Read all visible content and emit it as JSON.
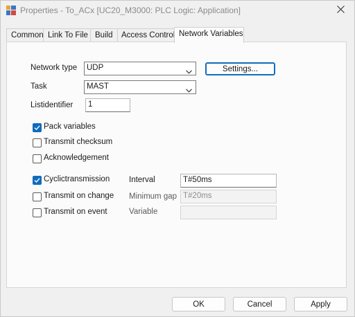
{
  "window": {
    "title": "Properties - To_ACx [UC20_M3000: PLC Logic: Application]",
    "close_icon": "close-icon",
    "app_icon": "properties-app-icon"
  },
  "tabs": [
    {
      "label": "Common",
      "active": false
    },
    {
      "label": "Link To File",
      "active": false
    },
    {
      "label": "Build",
      "active": false
    },
    {
      "label": "Access Control",
      "active": false
    },
    {
      "label": "Network Variables",
      "active": true
    }
  ],
  "form": {
    "network_type": {
      "label": "Network type",
      "value": "UDP"
    },
    "settings_button": "Settings...",
    "task": {
      "label": "Task",
      "value": "MAST"
    },
    "list_identifier": {
      "label": "Listidentifier",
      "value": "1"
    },
    "checkboxes": [
      {
        "label": "Pack variables",
        "checked": true
      },
      {
        "label": "Transmit checksum",
        "checked": false
      },
      {
        "label": "Acknowledgement",
        "checked": false
      },
      {
        "label": "Cyclictransmission",
        "checked": true
      },
      {
        "label": "Transmit on change",
        "checked": false
      },
      {
        "label": "Transmit on event",
        "checked": false
      }
    ],
    "interval": {
      "label": "Interval",
      "value": "T#50ms"
    },
    "minimum_gap": {
      "label": "Minimum gap",
      "value": "T#20ms"
    },
    "variable": {
      "label": "Variable",
      "value": ""
    }
  },
  "footer": {
    "ok": "OK",
    "cancel": "Cancel",
    "apply": "Apply"
  },
  "colors": {
    "accent": "#0f6cbd",
    "background": "#f0f0f0",
    "panel": "#fbfbfb"
  }
}
